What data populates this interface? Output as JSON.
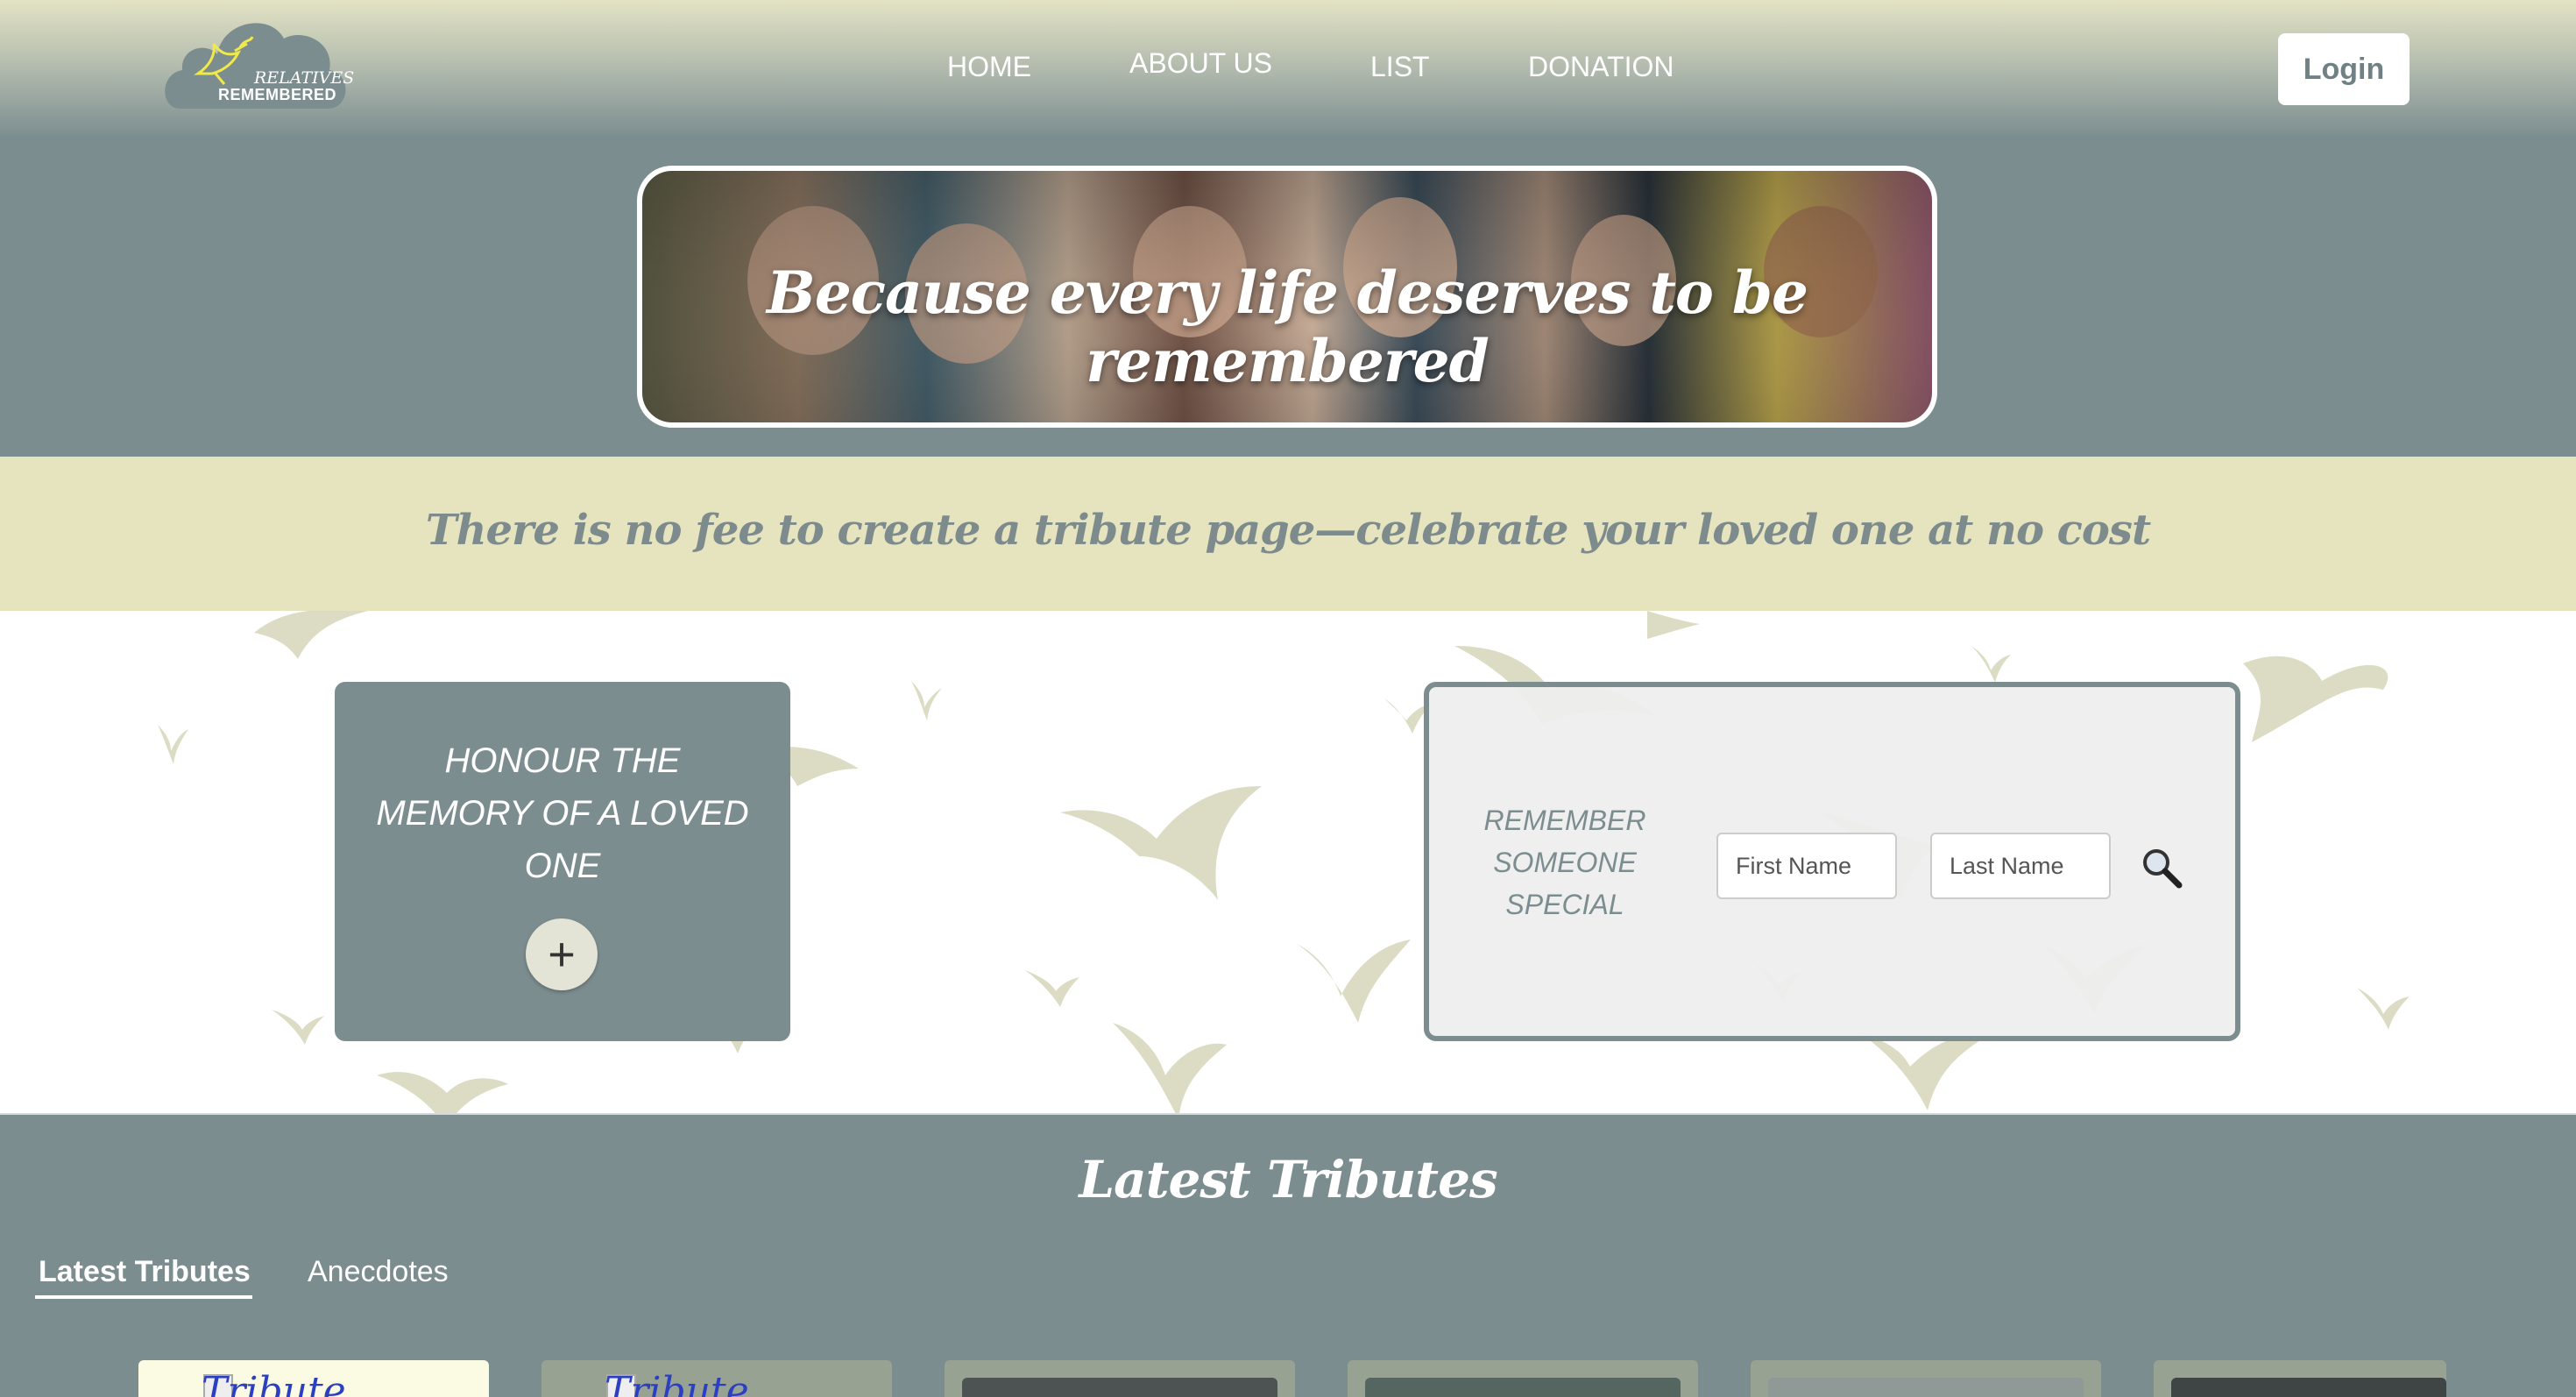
{
  "header": {
    "logo": {
      "line1": "RELATIVES",
      "line2": "REMEMBERED"
    },
    "nav": [
      {
        "label": "HOME"
      },
      {
        "label": "ABOUT US"
      },
      {
        "label": "LIST"
      },
      {
        "label": "DONATION"
      }
    ],
    "login_label": "Login"
  },
  "hero": {
    "banner_text": "Because every life deserves to be remembered",
    "fee_text": "There is no fee to create a tribute page—celebrate your loved one at no cost"
  },
  "honour": {
    "text": "HONOUR THE MEMORY OF A LOVED ONE",
    "plus_label": "+"
  },
  "search": {
    "label": "REMEMBER SOMEONE SPECIAL",
    "first_name_placeholder": "First Name",
    "last_name_placeholder": "Last Name"
  },
  "tributes": {
    "title": "Latest Tributes",
    "tabs": [
      {
        "label": "Latest Tributes",
        "active": true
      },
      {
        "label": "Anecdotes",
        "active": false
      }
    ],
    "card_alt_text": "Tribute heading"
  },
  "colors": {
    "primary": "#7c8d90",
    "accent_band": "#e6e4bf",
    "bird": "#dcdcc4"
  }
}
